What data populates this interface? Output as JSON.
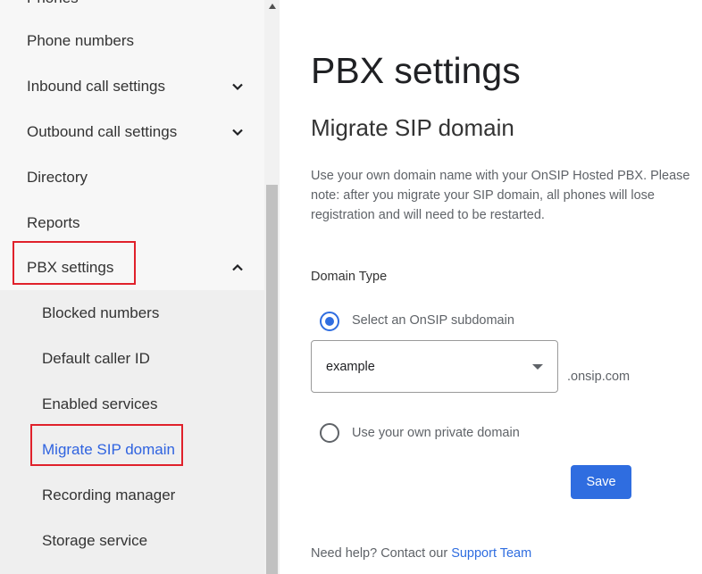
{
  "sidebar": {
    "partial_item": "Phones",
    "items": [
      {
        "label": "Phone numbers"
      },
      {
        "label": "Inbound call settings",
        "chevron": "chevron-down-icon"
      },
      {
        "label": "Outbound call settings",
        "chevron": "chevron-down-icon"
      },
      {
        "label": "Directory"
      },
      {
        "label": "Reports"
      },
      {
        "label": "PBX settings",
        "chevron": "chevron-up-icon"
      }
    ],
    "subitems": [
      {
        "label": "Blocked numbers"
      },
      {
        "label": "Default caller ID"
      },
      {
        "label": "Enabled services"
      },
      {
        "label": "Migrate SIP domain",
        "active": true
      },
      {
        "label": "Recording manager"
      },
      {
        "label": "Storage service"
      }
    ]
  },
  "main": {
    "page_title": "PBX settings",
    "section_title": "Migrate SIP domain",
    "description": "Use your own domain name with your OnSIP Hosted PBX. Please note: after you migrate your SIP domain, all phones will lose registration and will need to be restarted.",
    "domain_type_label": "Domain Type",
    "option_subdomain": "Select an OnSIP subdomain",
    "subdomain_value": "example",
    "suffix": ".onsip.com",
    "option_private": "Use your own private domain",
    "save_label": "Save",
    "help_text": "Need help? Contact our",
    "help_link": "Support Team"
  },
  "colors": {
    "accent": "#2f6de0",
    "highlight": "#e0212b",
    "sidebar_bg": "#f7f7f7",
    "submenu_bg": "#efefef"
  }
}
